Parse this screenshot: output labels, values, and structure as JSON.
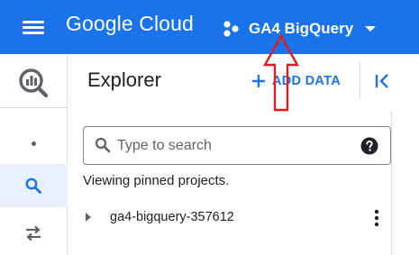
{
  "header": {
    "brand": "Google Cloud",
    "project_name": "GA4 BigQuery",
    "bar_color": "#1a73e8"
  },
  "rail": {
    "logo_icon": "bigquery-logo-icon",
    "items": [
      {
        "name": "more-dot-icon"
      },
      {
        "name": "search-icon",
        "active": true
      },
      {
        "name": "transfer-icon"
      }
    ]
  },
  "explorer": {
    "title": "Explorer",
    "add_data_label": "ADD DATA",
    "search_placeholder": "Type to search",
    "status": "Viewing pinned projects.",
    "projects": [
      {
        "label": "ga4-bigquery-357612"
      }
    ]
  },
  "annotation": {
    "type": "arrow",
    "color": "#e21b1b",
    "direction": "up"
  }
}
